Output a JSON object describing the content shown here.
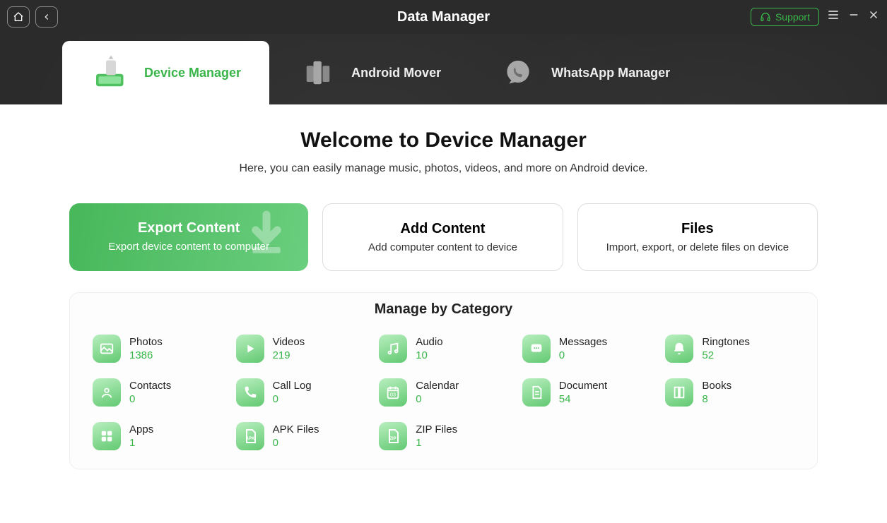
{
  "header": {
    "title": "Data Manager",
    "support_label": "Support"
  },
  "tabs": {
    "device_manager": "Device Manager",
    "android_mover": "Android Mover",
    "whatsapp_manager": "WhatsApp Manager"
  },
  "welcome": {
    "title": "Welcome to Device Manager",
    "subtitle": "Here, you can easily manage music, photos, videos, and more on Android device."
  },
  "cards": {
    "export": {
      "title": "Export Content",
      "sub": "Export device content to computer"
    },
    "add": {
      "title": "Add Content",
      "sub": "Add computer content to device"
    },
    "files": {
      "title": "Files",
      "sub": "Import, export, or delete files on device"
    }
  },
  "category_title": "Manage by Category",
  "categories": {
    "photos": {
      "name": "Photos",
      "count": "1386"
    },
    "videos": {
      "name": "Videos",
      "count": "219"
    },
    "audio": {
      "name": "Audio",
      "count": "10"
    },
    "messages": {
      "name": "Messages",
      "count": "0"
    },
    "ringtones": {
      "name": "Ringtones",
      "count": "52"
    },
    "contacts": {
      "name": "Contacts",
      "count": "0"
    },
    "calllog": {
      "name": "Call Log",
      "count": "0"
    },
    "calendar": {
      "name": "Calendar",
      "count": "0"
    },
    "document": {
      "name": "Document",
      "count": "54"
    },
    "books": {
      "name": "Books",
      "count": "8"
    },
    "apps": {
      "name": "Apps",
      "count": "1"
    },
    "apk": {
      "name": "APK Files",
      "count": "0"
    },
    "zip": {
      "name": "ZIP Files",
      "count": "1"
    }
  }
}
